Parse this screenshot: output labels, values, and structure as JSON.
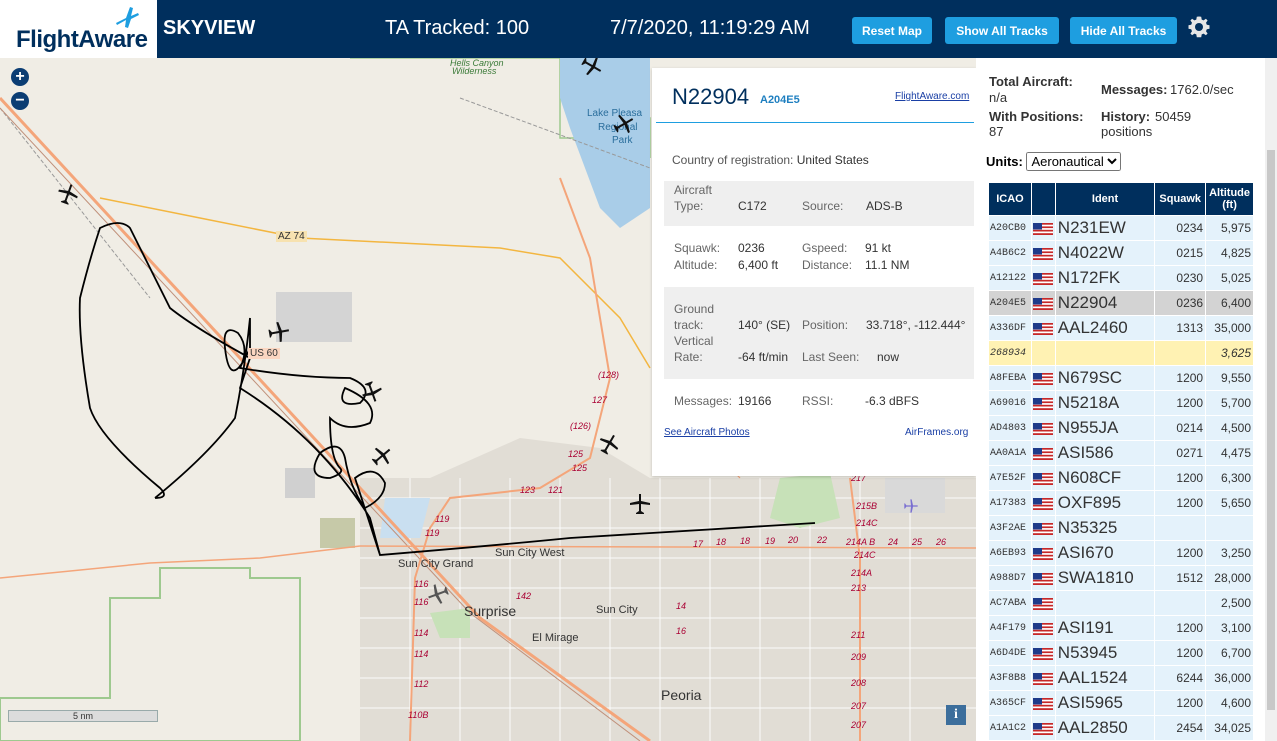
{
  "header": {
    "logo": "FlightAware",
    "site_name": "SKYVIEW",
    "ta_tracked": "TA Tracked: 100",
    "clock": "7/7/2020, 11:19:29 AM",
    "buttons": {
      "reset_map": "Reset Map",
      "show_all_tracks": "Show All Tracks",
      "hide_all_tracks": "Hide All Tracks"
    },
    "settings_icon": "gear-icon"
  },
  "map": {
    "zoom_in": "+",
    "zoom_out": "−",
    "scale": "5 nm",
    "info": "i",
    "labels": {
      "az74": "AZ 74",
      "us60": "US 60",
      "wilderness1": "Hells Canyon",
      "wilderness2": "Wilderness",
      "lake1": "Lake Pleasa",
      "lake2": "Regional",
      "lake3": "Park",
      "sun_city_west": "Sun City West",
      "sun_city_grand": "Sun City Grand",
      "surprise": "Surprise",
      "sun_city": "Sun City",
      "el_mirage": "El Mirage",
      "peoria": "Peoria",
      "r128": "(128)",
      "r127": "127",
      "r126": "(126)",
      "r125a": "125",
      "r125b": "125",
      "r123": "123",
      "r121": "121",
      "r119a": "119",
      "r119b": "119",
      "r117": "117",
      "r116a": "116",
      "r116b": "116",
      "r114a": "114",
      "r114b": "114",
      "r112": "112",
      "r110b": "110B",
      "r142": "142",
      "r14": "14",
      "r16": "16",
      "r17": "17",
      "r18": "18",
      "r19": "19",
      "r20": "20",
      "r22": "22",
      "r214ab": "214A B",
      "r214c1": "214C",
      "r214c2": "214C",
      "r215b": "215B",
      "r214a": "214A",
      "r213": "213",
      "r211": "211",
      "r210": "210",
      "r209": "209",
      "r208": "208",
      "r207a": "207",
      "r207b": "207",
      "r217": "217",
      "r24": "24",
      "r25": "25",
      "r26": "26",
      "r4": "4"
    }
  },
  "popup": {
    "ident": "N22904",
    "icao": "A204E5",
    "fa_link": "FlightAware.com",
    "country_label": "Country of registration:",
    "country_value": "United States",
    "aircraft_type_label1": "Aircraft",
    "aircraft_type_label2": "Type:",
    "aircraft_type_value": "C172",
    "source_label": "Source:",
    "source_value": "ADS-B",
    "squawk_label": "Squawk:",
    "squawk_value": "0236",
    "gspeed_label": "Gspeed:",
    "gspeed_value": "91 kt",
    "altitude_label": "Altitude:",
    "altitude_value": "6,400 ft",
    "distance_label": "Distance:",
    "distance_value": "11.1 NM",
    "ground_label1": "Ground",
    "ground_label2": "track:",
    "ground_value": "140° (SE)",
    "position_label": "Position:",
    "position_value": "33.718°, -112.444°",
    "vrate_label1": "Vertical",
    "vrate_label2": "Rate:",
    "vrate_value": "-64 ft/min",
    "last_seen_label": "Last Seen:",
    "last_seen_value": "now",
    "messages_label": "Messages:",
    "messages_value": "19166",
    "rssi_label": "RSSI:",
    "rssi_value": "-6.3 dBFS",
    "photos_link": "See Aircraft Photos",
    "airframes_link": "AirFrames.org"
  },
  "panel": {
    "total_aircraft_label": "Total Aircraft:",
    "total_aircraft_value": "n/a",
    "with_positions_label": "With Positions:",
    "with_positions_value": "87",
    "messages_label": "Messages:",
    "messages_value": "1762.0/sec",
    "history_label": "History:",
    "history_value1": "50459",
    "history_value2": "positions",
    "units_label": "Units:",
    "units_value": "Aeronautical",
    "columns": [
      "ICAO",
      "Ident",
      "Squawk",
      "Altitude (ft)"
    ],
    "rows": [
      {
        "icao": "A20CB0",
        "flag": true,
        "ident": "N231EW",
        "squawk": "0234",
        "alt": "5,975"
      },
      {
        "icao": "A4B6C2",
        "flag": true,
        "ident": "N4022W",
        "squawk": "0215",
        "alt": "4,825"
      },
      {
        "icao": "A12122",
        "flag": true,
        "ident": "N172FK",
        "squawk": "0230",
        "alt": "5,025"
      },
      {
        "icao": "A204E5",
        "flag": true,
        "ident": "N22904",
        "squawk": "0236",
        "alt": "6,400",
        "selected": true
      },
      {
        "icao": "A336DF",
        "flag": true,
        "ident": "AAL2460",
        "squawk": "1313",
        "alt": "35,000"
      },
      {
        "icao": "268934",
        "flag": false,
        "ident": "",
        "squawk": "",
        "alt": "3,625",
        "noloc": true
      },
      {
        "icao": "A8FEBA",
        "flag": true,
        "ident": "N679SC",
        "squawk": "1200",
        "alt": "9,550"
      },
      {
        "icao": "A69016",
        "flag": true,
        "ident": "N5218A",
        "squawk": "1200",
        "alt": "5,700"
      },
      {
        "icao": "AD4803",
        "flag": true,
        "ident": "N955JA",
        "squawk": "0214",
        "alt": "4,500"
      },
      {
        "icao": "AA0A1A",
        "flag": true,
        "ident": "ASI586",
        "squawk": "0271",
        "alt": "4,475"
      },
      {
        "icao": "A7E52F",
        "flag": true,
        "ident": "N608CF",
        "squawk": "1200",
        "alt": "6,300"
      },
      {
        "icao": "A17383",
        "flag": true,
        "ident": "OXF895",
        "squawk": "1200",
        "alt": "5,650"
      },
      {
        "icao": "A3F2AE",
        "flag": true,
        "ident": "N35325",
        "squawk": "",
        "alt": ""
      },
      {
        "icao": "A6EB93",
        "flag": true,
        "ident": "ASI670",
        "squawk": "1200",
        "alt": "3,250"
      },
      {
        "icao": "A988D7",
        "flag": true,
        "ident": "SWA1810",
        "squawk": "1512",
        "alt": "28,000"
      },
      {
        "icao": "AC7ABA",
        "flag": true,
        "ident": "",
        "squawk": "",
        "alt": "2,500"
      },
      {
        "icao": "A4F179",
        "flag": true,
        "ident": "ASI191",
        "squawk": "1200",
        "alt": "3,100"
      },
      {
        "icao": "A6D4DE",
        "flag": true,
        "ident": "N53945",
        "squawk": "1200",
        "alt": "6,700"
      },
      {
        "icao": "A3F8B8",
        "flag": true,
        "ident": "AAL1524",
        "squawk": "6244",
        "alt": "36,000"
      },
      {
        "icao": "A365CF",
        "flag": true,
        "ident": "ASI5965",
        "squawk": "1200",
        "alt": "4,600"
      },
      {
        "icao": "A1A1C2",
        "flag": true,
        "ident": "AAL2850",
        "squawk": "2454",
        "alt": "34,025"
      }
    ]
  },
  "colors": {
    "header_bg": "#002f5d",
    "button_bg": "#1e9ee0",
    "row_bg": "#e4f2fb",
    "selected_bg": "#d3d3d3",
    "noloc_bg": "#fff2b3",
    "track": "#000000",
    "road": "#f4a57a",
    "highway": "#f3b640",
    "water": "#a9cde8"
  }
}
